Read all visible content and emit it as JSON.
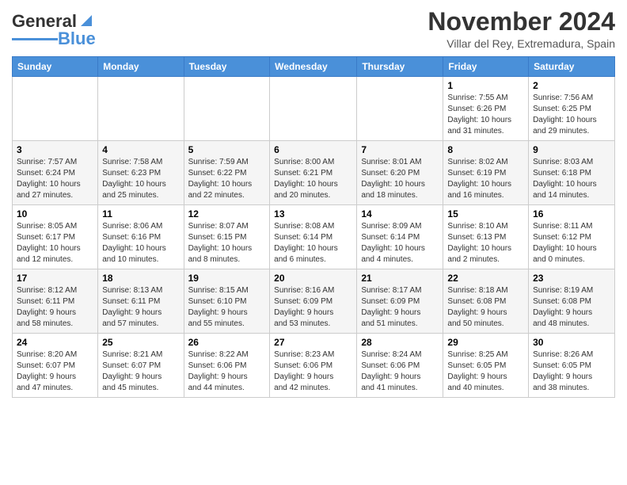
{
  "header": {
    "logo_general": "General",
    "logo_blue": "Blue",
    "month": "November 2024",
    "location": "Villar del Rey, Extremadura, Spain"
  },
  "weekdays": [
    "Sunday",
    "Monday",
    "Tuesday",
    "Wednesday",
    "Thursday",
    "Friday",
    "Saturday"
  ],
  "weeks": [
    [
      {
        "day": "",
        "info": ""
      },
      {
        "day": "",
        "info": ""
      },
      {
        "day": "",
        "info": ""
      },
      {
        "day": "",
        "info": ""
      },
      {
        "day": "",
        "info": ""
      },
      {
        "day": "1",
        "info": "Sunrise: 7:55 AM\nSunset: 6:26 PM\nDaylight: 10 hours\nand 31 minutes."
      },
      {
        "day": "2",
        "info": "Sunrise: 7:56 AM\nSunset: 6:25 PM\nDaylight: 10 hours\nand 29 minutes."
      }
    ],
    [
      {
        "day": "3",
        "info": "Sunrise: 7:57 AM\nSunset: 6:24 PM\nDaylight: 10 hours\nand 27 minutes."
      },
      {
        "day": "4",
        "info": "Sunrise: 7:58 AM\nSunset: 6:23 PM\nDaylight: 10 hours\nand 25 minutes."
      },
      {
        "day": "5",
        "info": "Sunrise: 7:59 AM\nSunset: 6:22 PM\nDaylight: 10 hours\nand 22 minutes."
      },
      {
        "day": "6",
        "info": "Sunrise: 8:00 AM\nSunset: 6:21 PM\nDaylight: 10 hours\nand 20 minutes."
      },
      {
        "day": "7",
        "info": "Sunrise: 8:01 AM\nSunset: 6:20 PM\nDaylight: 10 hours\nand 18 minutes."
      },
      {
        "day": "8",
        "info": "Sunrise: 8:02 AM\nSunset: 6:19 PM\nDaylight: 10 hours\nand 16 minutes."
      },
      {
        "day": "9",
        "info": "Sunrise: 8:03 AM\nSunset: 6:18 PM\nDaylight: 10 hours\nand 14 minutes."
      }
    ],
    [
      {
        "day": "10",
        "info": "Sunrise: 8:05 AM\nSunset: 6:17 PM\nDaylight: 10 hours\nand 12 minutes."
      },
      {
        "day": "11",
        "info": "Sunrise: 8:06 AM\nSunset: 6:16 PM\nDaylight: 10 hours\nand 10 minutes."
      },
      {
        "day": "12",
        "info": "Sunrise: 8:07 AM\nSunset: 6:15 PM\nDaylight: 10 hours\nand 8 minutes."
      },
      {
        "day": "13",
        "info": "Sunrise: 8:08 AM\nSunset: 6:14 PM\nDaylight: 10 hours\nand 6 minutes."
      },
      {
        "day": "14",
        "info": "Sunrise: 8:09 AM\nSunset: 6:14 PM\nDaylight: 10 hours\nand 4 minutes."
      },
      {
        "day": "15",
        "info": "Sunrise: 8:10 AM\nSunset: 6:13 PM\nDaylight: 10 hours\nand 2 minutes."
      },
      {
        "day": "16",
        "info": "Sunrise: 8:11 AM\nSunset: 6:12 PM\nDaylight: 10 hours\nand 0 minutes."
      }
    ],
    [
      {
        "day": "17",
        "info": "Sunrise: 8:12 AM\nSunset: 6:11 PM\nDaylight: 9 hours\nand 58 minutes."
      },
      {
        "day": "18",
        "info": "Sunrise: 8:13 AM\nSunset: 6:11 PM\nDaylight: 9 hours\nand 57 minutes."
      },
      {
        "day": "19",
        "info": "Sunrise: 8:15 AM\nSunset: 6:10 PM\nDaylight: 9 hours\nand 55 minutes."
      },
      {
        "day": "20",
        "info": "Sunrise: 8:16 AM\nSunset: 6:09 PM\nDaylight: 9 hours\nand 53 minutes."
      },
      {
        "day": "21",
        "info": "Sunrise: 8:17 AM\nSunset: 6:09 PM\nDaylight: 9 hours\nand 51 minutes."
      },
      {
        "day": "22",
        "info": "Sunrise: 8:18 AM\nSunset: 6:08 PM\nDaylight: 9 hours\nand 50 minutes."
      },
      {
        "day": "23",
        "info": "Sunrise: 8:19 AM\nSunset: 6:08 PM\nDaylight: 9 hours\nand 48 minutes."
      }
    ],
    [
      {
        "day": "24",
        "info": "Sunrise: 8:20 AM\nSunset: 6:07 PM\nDaylight: 9 hours\nand 47 minutes."
      },
      {
        "day": "25",
        "info": "Sunrise: 8:21 AM\nSunset: 6:07 PM\nDaylight: 9 hours\nand 45 minutes."
      },
      {
        "day": "26",
        "info": "Sunrise: 8:22 AM\nSunset: 6:06 PM\nDaylight: 9 hours\nand 44 minutes."
      },
      {
        "day": "27",
        "info": "Sunrise: 8:23 AM\nSunset: 6:06 PM\nDaylight: 9 hours\nand 42 minutes."
      },
      {
        "day": "28",
        "info": "Sunrise: 8:24 AM\nSunset: 6:06 PM\nDaylight: 9 hours\nand 41 minutes."
      },
      {
        "day": "29",
        "info": "Sunrise: 8:25 AM\nSunset: 6:05 PM\nDaylight: 9 hours\nand 40 minutes."
      },
      {
        "day": "30",
        "info": "Sunrise: 8:26 AM\nSunset: 6:05 PM\nDaylight: 9 hours\nand 38 minutes."
      }
    ]
  ]
}
